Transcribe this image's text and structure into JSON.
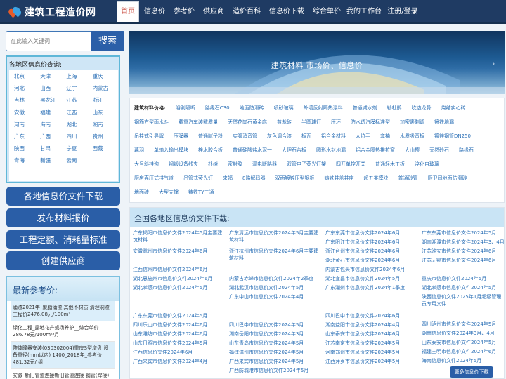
{
  "header": {
    "logo_text": "建筑工程造价网",
    "nav": [
      "首页",
      "信息价",
      "参考价",
      "供应商",
      "造价百科",
      "信息价下载",
      "综合单价",
      "我的工作台",
      "注册/登录"
    ]
  },
  "sidebar": {
    "search_placeholder": "在此输入关键词",
    "search_button": "搜索",
    "region_title": "各地区信息价查询:",
    "regions": [
      [
        "北京",
        "天津",
        "上海",
        "重庆"
      ],
      [
        "河北",
        "山西",
        "辽宁",
        "内蒙古"
      ],
      [
        "吉林",
        "黑龙江",
        "江苏",
        "浙江"
      ],
      [
        "安徽",
        "福建",
        "江西",
        "山东"
      ],
      [
        "河南",
        "海南",
        "湖北",
        "湖南"
      ],
      [
        "广东",
        "广西",
        "四川",
        "贵州"
      ],
      [
        "陕西",
        "甘肃",
        "宁夏",
        "西藏"
      ],
      [
        "青海",
        "新疆",
        "云南",
        ""
      ]
    ],
    "buttons": [
      "各地信息价文件下载",
      "发布材料报价",
      "工程定额、消耗量标准",
      "创建供应商"
    ],
    "recent_title": "最新参考价:",
    "recent_items": [
      "涌渣2021年_聚脂涌渣 其他不材质 清理洞渣_工程价2476.08元/100m²",
      "绿化工程_露地花卉或场养护__综合单价286.78元/100m²/月",
      "整体瞳器安装(030302004)重庆S型增盘 设备重径(mm以内) 1400_2018年_参考价481.32元/ 组",
      "安徽_新旧管道连接新旧管道连接 钢管(焊接) 公称直径(mm以内) 1000 _安额单价3261.46元/处"
    ]
  },
  "banner": {
    "text": "建筑材料 市场价、信息价",
    "prev": "‹",
    "next": "›"
  },
  "materials": {
    "label": "建筑材料价格:",
    "rows": [
      [
        "浴割隔断",
        "路缘石C30",
        "地面防滑砖",
        "喷砂玻璃",
        "外墙反射隔热涂料",
        "普通减水剂",
        "勒杜鹃",
        "吹边龙骨",
        "烧结实心砖"
      ],
      [
        "钢筋方型雨水斗",
        "载重汽车装载质量",
        "天然花岗石黄金麻",
        "剪裁砖",
        "半圆球灯",
        "压环",
        "防水透汽膜标准型",
        "加密裹剩调",
        "镜铁地漏"
      ],
      [
        "吊挂式引导牌",
        "压膜器",
        "普通腻子粉",
        "实腹消音管",
        "灰色调合漆",
        "板瓦",
        "铝合金材料",
        "大垃手",
        "套袖",
        "木质吸音板",
        "镀锌钢管DN250"
      ],
      [
        "暮羽",
        "单输入输出模块",
        "梓木胶合板",
        "普通硅酸盐水泥一",
        "大理石台板",
        "圆形水封地漏",
        "铝合金隔热推拉窗",
        "大山樱",
        "天然砂石",
        "路缘石"
      ],
      [
        "大号斜挂沟",
        "钢锻设备线夹",
        "朴树",
        "密封胶",
        "漏电断路器",
        "双管电子荧光灯架",
        "四开单控开关",
        "普通轻木工板",
        "淬化自玻璃"
      ],
      [
        "厨房壳压式排气道",
        "吊管式荧光灯",
        "来福",
        "8路解码器",
        "双面镀锌压型钢板",
        "铸铁井盖井座",
        "超五类模块",
        "普通砂管",
        "厨卫间地面防滑砖"
      ],
      [
        "地面砖",
        "大型支撑",
        "铸铁TY三通"
      ]
    ]
  },
  "info_list": {
    "title": "全国各地区信息价文件下载:",
    "columns": [
      [
        "广东揭阳市信息价文件2024年5月主要建筑材料",
        "安徽滁州市信息价文件2024年6月",
        "",
        "江西信州市信息价文件2024年6月",
        "湖北恩施州市信息价文件2024年6月",
        "湖北孝感市信息价文件2024年5月",
        "",
        "广东东莞市信息价文件2024年5月",
        "四川乐山市信息价文件2024年6月",
        "山东潍坊市信息价文件2024年6月",
        "山东日照市信息价文件2024年5月",
        "江西信息价文件2024年6月",
        "广西来宾市信息价文件2024年4月"
      ],
      [
        "广东清远市信息价文件2024年5月主要建筑材料",
        "浙江杭州市信息价文件2024年6月主要建筑材料",
        "",
        "内蒙古赤峰市信息价文件2024年2季度",
        "湖北武汉市信息价文件2024年5月",
        "广东中山市信息价文件2024年4月",
        "",
        "四川巴中市信息价文件2024年5月",
        "湖南岳阳市信息价文件2024年3月",
        "山东青岛市信息价文件2024年5月",
        "福建漳州市信息价文件2024年5月",
        "广西来宾市信息价文件2024年5月",
        "广西防城港市信息价文件2024年5月"
      ],
      [
        "广东东莞市信息价文件2024年6月",
        "广东阳江市信息价文件2024年6月",
        "浙江台州市信息价文件2024年6月",
        "湖北黄石市信息价文件2024年6月",
        "内蒙古包头市信息价文件2024年6月",
        "湖北宜昌市信息价文件2024年5月",
        "广东潮州市信息价文件2024年1季度",
        "",
        "四川巴中市信息价文件2024年6月",
        "湖南益阳市信息价文件2024年4月",
        "山东泰安市信息价文件2024年6月",
        "江苏南京市信息价文件2024年5月",
        "河南郑州市信息价文件2024年5月",
        "江西萍乡市信息价文件2024年5月"
      ],
      [
        "广东东莞市信息价文件2024年5月",
        "湖南湘潭市信息价文件2024年3、4月",
        "江苏淮安市信息价文件2024年6月",
        "江苏无锡市信息价文件2024年6月",
        "",
        "重庆市信息价文件2024年5月",
        "湖北孝感市信息价文件2024年5月",
        "陕西信息价文件2025年1月超级管理员专用文件",
        "",
        "四川泸州市信息价文件2024年5月",
        "湖南信息价文件2024年3月、4月",
        "山东泰安市信息价文件2024年5月",
        "福建三明市信息价文件2024年6月",
        "海南信息价文件2024年5月",
        "广西贵港市信息价文件2024年5月"
      ]
    ],
    "more_button": "更多信息价下载"
  }
}
